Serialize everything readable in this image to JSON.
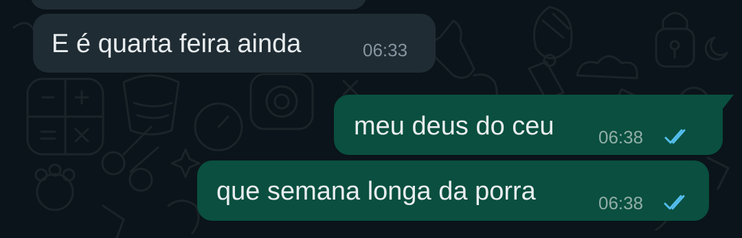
{
  "colors": {
    "background": "#0b141a",
    "incoming_bubble": "#1f2c34",
    "outgoing_bubble": "#0a4f3f",
    "text": "#e9edef",
    "time_incoming": "#8696a0",
    "read_ticks": "#53bdeb"
  },
  "messages": [
    {
      "direction": "incoming",
      "text": "E é quarta feira ainda",
      "time": "06:33"
    },
    {
      "direction": "outgoing",
      "text": "meu deus do ceu",
      "time": "06:38",
      "status_icon": "double-check-read-icon"
    },
    {
      "direction": "outgoing",
      "text": "que semana longa da porra",
      "time": "06:38",
      "status_icon": "double-check-read-icon"
    }
  ]
}
